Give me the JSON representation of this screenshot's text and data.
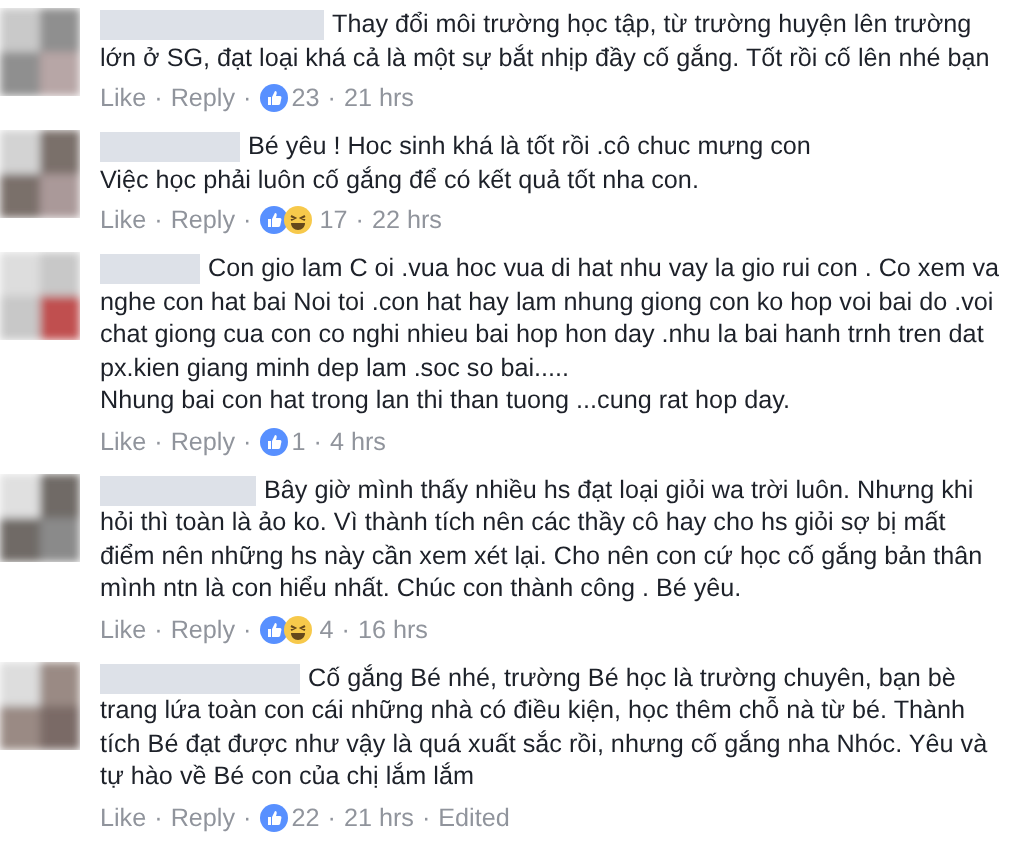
{
  "separator": "·",
  "comments": [
    {
      "paragraphs": [
        "Thay đổi môi trường học tập, từ trường huyện lên trường lớn ở SG, đạt loại khá cả là một sự bắt nhịp đầy cố gắng. Tốt rồi cố lên nhé bạn"
      ],
      "actions": [
        "Like",
        "Reply"
      ],
      "reactions": [
        {
          "kind": "like"
        }
      ],
      "count": "23",
      "time": "21 hrs"
    },
    {
      "paragraphs": [
        "Bé yêu ! Hoc sinh khá là tốt rồi .cô chuc mưng con",
        "Việc học phải luôn cố gắng để có kết quả tốt nha con."
      ],
      "actions": [
        "Like",
        "Reply"
      ],
      "reactions": [
        {
          "kind": "like"
        },
        {
          "kind": "haha"
        }
      ],
      "count": "17",
      "time": "22 hrs"
    },
    {
      "paragraphs": [
        "Con gio lam C oi .vua hoc vua di hat nhu vay la gio rui con . Co xem va nghe con hat bai Noi toi .con hat hay lam nhung giong con ko hop voi bai do .voi chat giong cua con co nghi nhieu bai hop hon day .nhu la bai hanh trnh tren dat px.kien giang minh dep lam .soc so bai.....",
        "Nhung bai con hat trong lan thi than tuong ...cung rat hop day."
      ],
      "actions": [
        "Like",
        "Reply"
      ],
      "reactions": [
        {
          "kind": "like"
        }
      ],
      "count": "1",
      "time": "4 hrs"
    },
    {
      "paragraphs": [
        "Bây giờ mình thấy nhiều hs đạt loại giỏi wa trời luôn. Nhưng khi hỏi thì toàn là ảo ko. Vì thành tích nên các thầy cô hay cho hs giỏi sợ bị mất điểm nên những hs này cần xem xét lại. Cho nên con cứ học cố gắng bản thân mình ntn là con hiểu nhất. Chúc con thành công . Bé yêu."
      ],
      "actions": [
        "Like",
        "Reply"
      ],
      "reactions": [
        {
          "kind": "like"
        },
        {
          "kind": "haha"
        }
      ],
      "count": "4",
      "time": "16 hrs"
    },
    {
      "paragraphs": [
        "Cố gắng Bé nhé, trường Bé học là trường chuyên, bạn bè trang lứa toàn con cái những nhà có điều kiện, học thêm chỗ nà từ bé. Thành tích Bé đạt được như vậy là quá xuất sắc rồi, nhưng cố gắng nha Nhóc. Yêu và tự hào về Bé con của chị lắm lắm"
      ],
      "actions": [
        "Like",
        "Reply"
      ],
      "reactions": [
        {
          "kind": "like"
        }
      ],
      "count": "22",
      "time": "21 hrs",
      "edited": "Edited"
    }
  ]
}
